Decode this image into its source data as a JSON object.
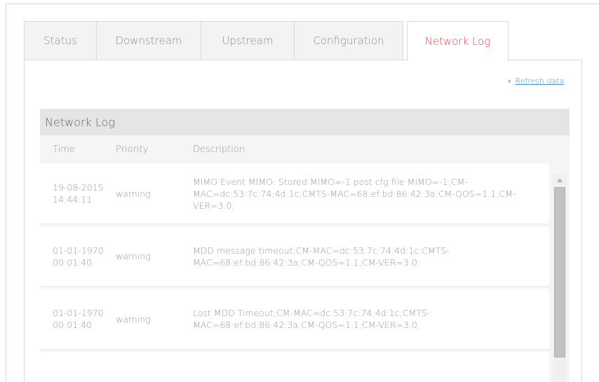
{
  "tabs": [
    {
      "label": "Status",
      "active": false
    },
    {
      "label": "Downstream",
      "active": false
    },
    {
      "label": "Upstream",
      "active": false
    },
    {
      "label": "Configuration",
      "active": false
    },
    {
      "label": "Network Log",
      "active": true
    }
  ],
  "refresh": {
    "label": "Refresh data",
    "icon": "chevron-right-icon"
  },
  "log": {
    "title": "Network Log",
    "columns": {
      "time": "Time",
      "priority": "Priority",
      "description": "Description"
    },
    "rows": [
      {
        "time": "19-08-2015 14:44:11",
        "priority": "warning",
        "description": "MIMO Event MIMO: Stored MIMO=-1 post cfg file MIMO=-1;CM-MAC=dc:53:7c:74:4d:1c;CMTS-MAC=68:ef:bd:86:42:3a;CM-QOS=1.1;CM-VER=3.0;"
      },
      {
        "time": "01-01-1970 00:01:40",
        "priority": "warning",
        "description": "MDD message timeout;CM-MAC=dc:53:7c:74:4d:1c;CMTS-MAC=68:ef:bd:86:42:3a;CM-QOS=1.1;CM-VER=3.0;"
      },
      {
        "time": "01-01-1970 00:01:40",
        "priority": "warning",
        "description": "Lost MDD Timeout;CM-MAC=dc:53:7c:74:4d:1c;CMTS-MAC=68:ef:bd:86:42:3a;CM-QOS=1.1;CM-VER=3.0;"
      },
      {
        "time": "",
        "priority": "",
        "description": ""
      }
    ]
  },
  "colors": {
    "accent": "#e8464f",
    "link": "#4a90c8"
  }
}
